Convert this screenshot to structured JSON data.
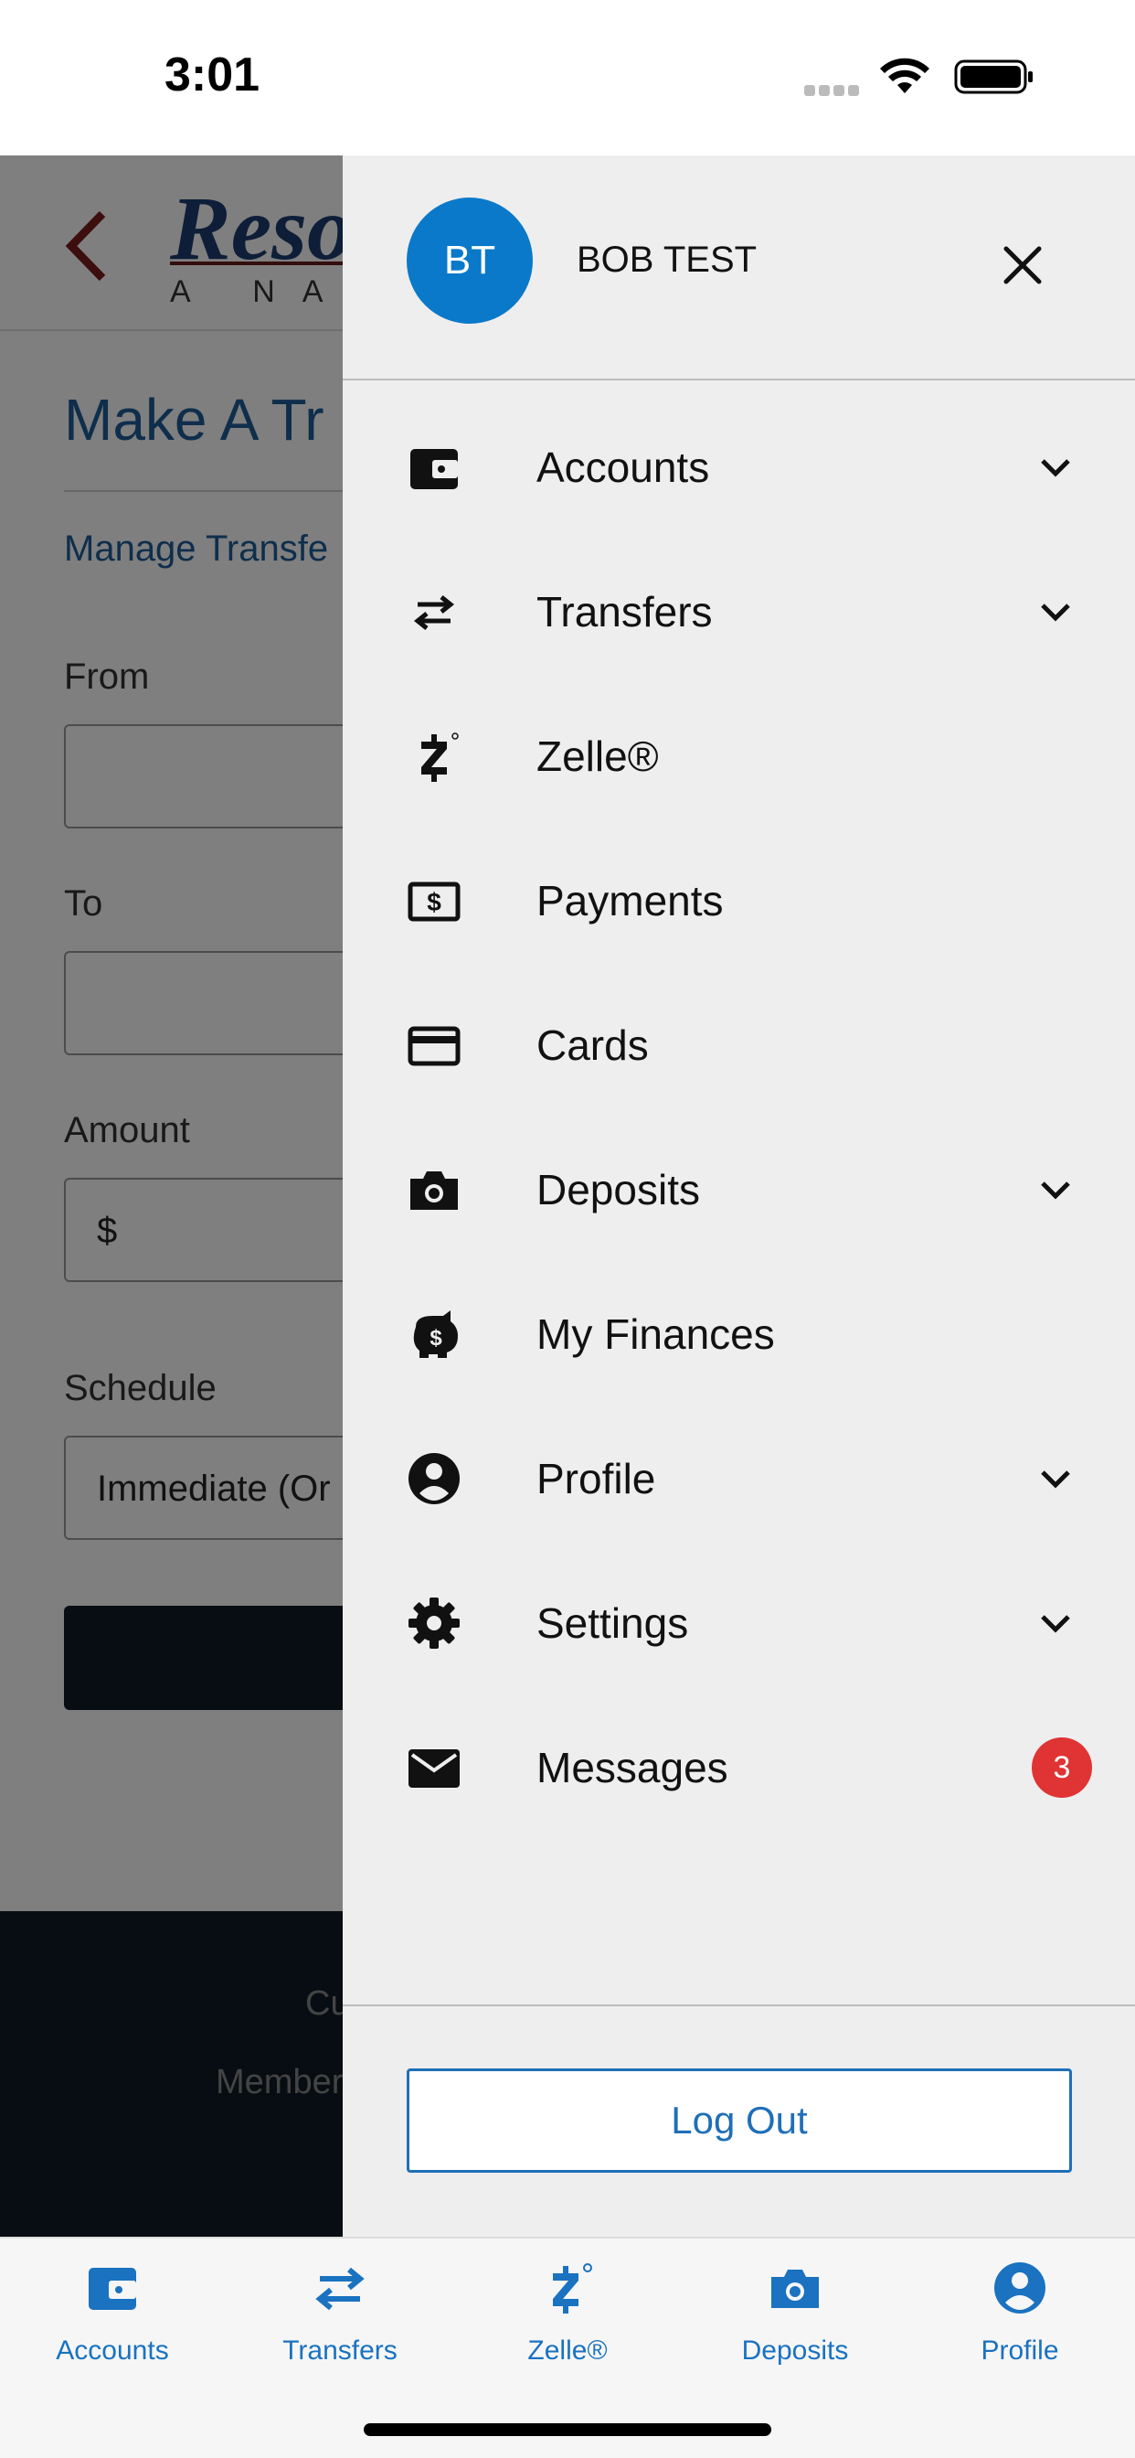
{
  "status_bar": {
    "time": "3:01"
  },
  "background_page": {
    "logo_text": "Reso",
    "logo_subtext": "A NAT",
    "title": "Make A Tr",
    "manage_link": "Manage Transfe",
    "fields": [
      {
        "label": "From",
        "value": ""
      },
      {
        "label": "To",
        "value": ""
      },
      {
        "label": "Amount",
        "value": "$"
      },
      {
        "label": "Schedule",
        "value": "Immediate (Or"
      }
    ],
    "footer_line1": "Cu",
    "footer_line2": "Member"
  },
  "drawer": {
    "avatar_initials": "BT",
    "user_name": "BOB TEST",
    "menu": [
      {
        "label": "Accounts",
        "icon": "wallet-icon",
        "expandable": true
      },
      {
        "label": "Transfers",
        "icon": "transfer-arrows-icon",
        "expandable": true
      },
      {
        "label": "Zelle®",
        "icon": "zelle-icon",
        "expandable": false
      },
      {
        "label": "Payments",
        "icon": "dollar-bill-icon",
        "expandable": false
      },
      {
        "label": "Cards",
        "icon": "credit-card-icon",
        "expandable": false
      },
      {
        "label": "Deposits",
        "icon": "camera-icon",
        "expandable": true
      },
      {
        "label": "My Finances",
        "icon": "piggy-bank-icon",
        "expandable": false
      },
      {
        "label": "Profile",
        "icon": "person-circle-icon",
        "expandable": true
      },
      {
        "label": "Settings",
        "icon": "gear-icon",
        "expandable": true
      },
      {
        "label": "Messages",
        "icon": "envelope-icon",
        "expandable": false,
        "badge": "3"
      }
    ],
    "logout_label": "Log Out"
  },
  "tab_bar": {
    "tabs": [
      {
        "label": "Accounts",
        "icon": "wallet-icon"
      },
      {
        "label": "Transfers",
        "icon": "transfer-arrows-icon"
      },
      {
        "label": "Zelle®",
        "icon": "zelle-icon"
      },
      {
        "label": "Deposits",
        "icon": "camera-icon"
      },
      {
        "label": "Profile",
        "icon": "person-circle-icon"
      }
    ]
  },
  "colors": {
    "brand_blue": "#0a79c9",
    "link_blue": "#1f6fb8",
    "badge_red": "#e03333",
    "drawer_bg": "#eeeeee",
    "footer_dark": "#0e1a24"
  }
}
